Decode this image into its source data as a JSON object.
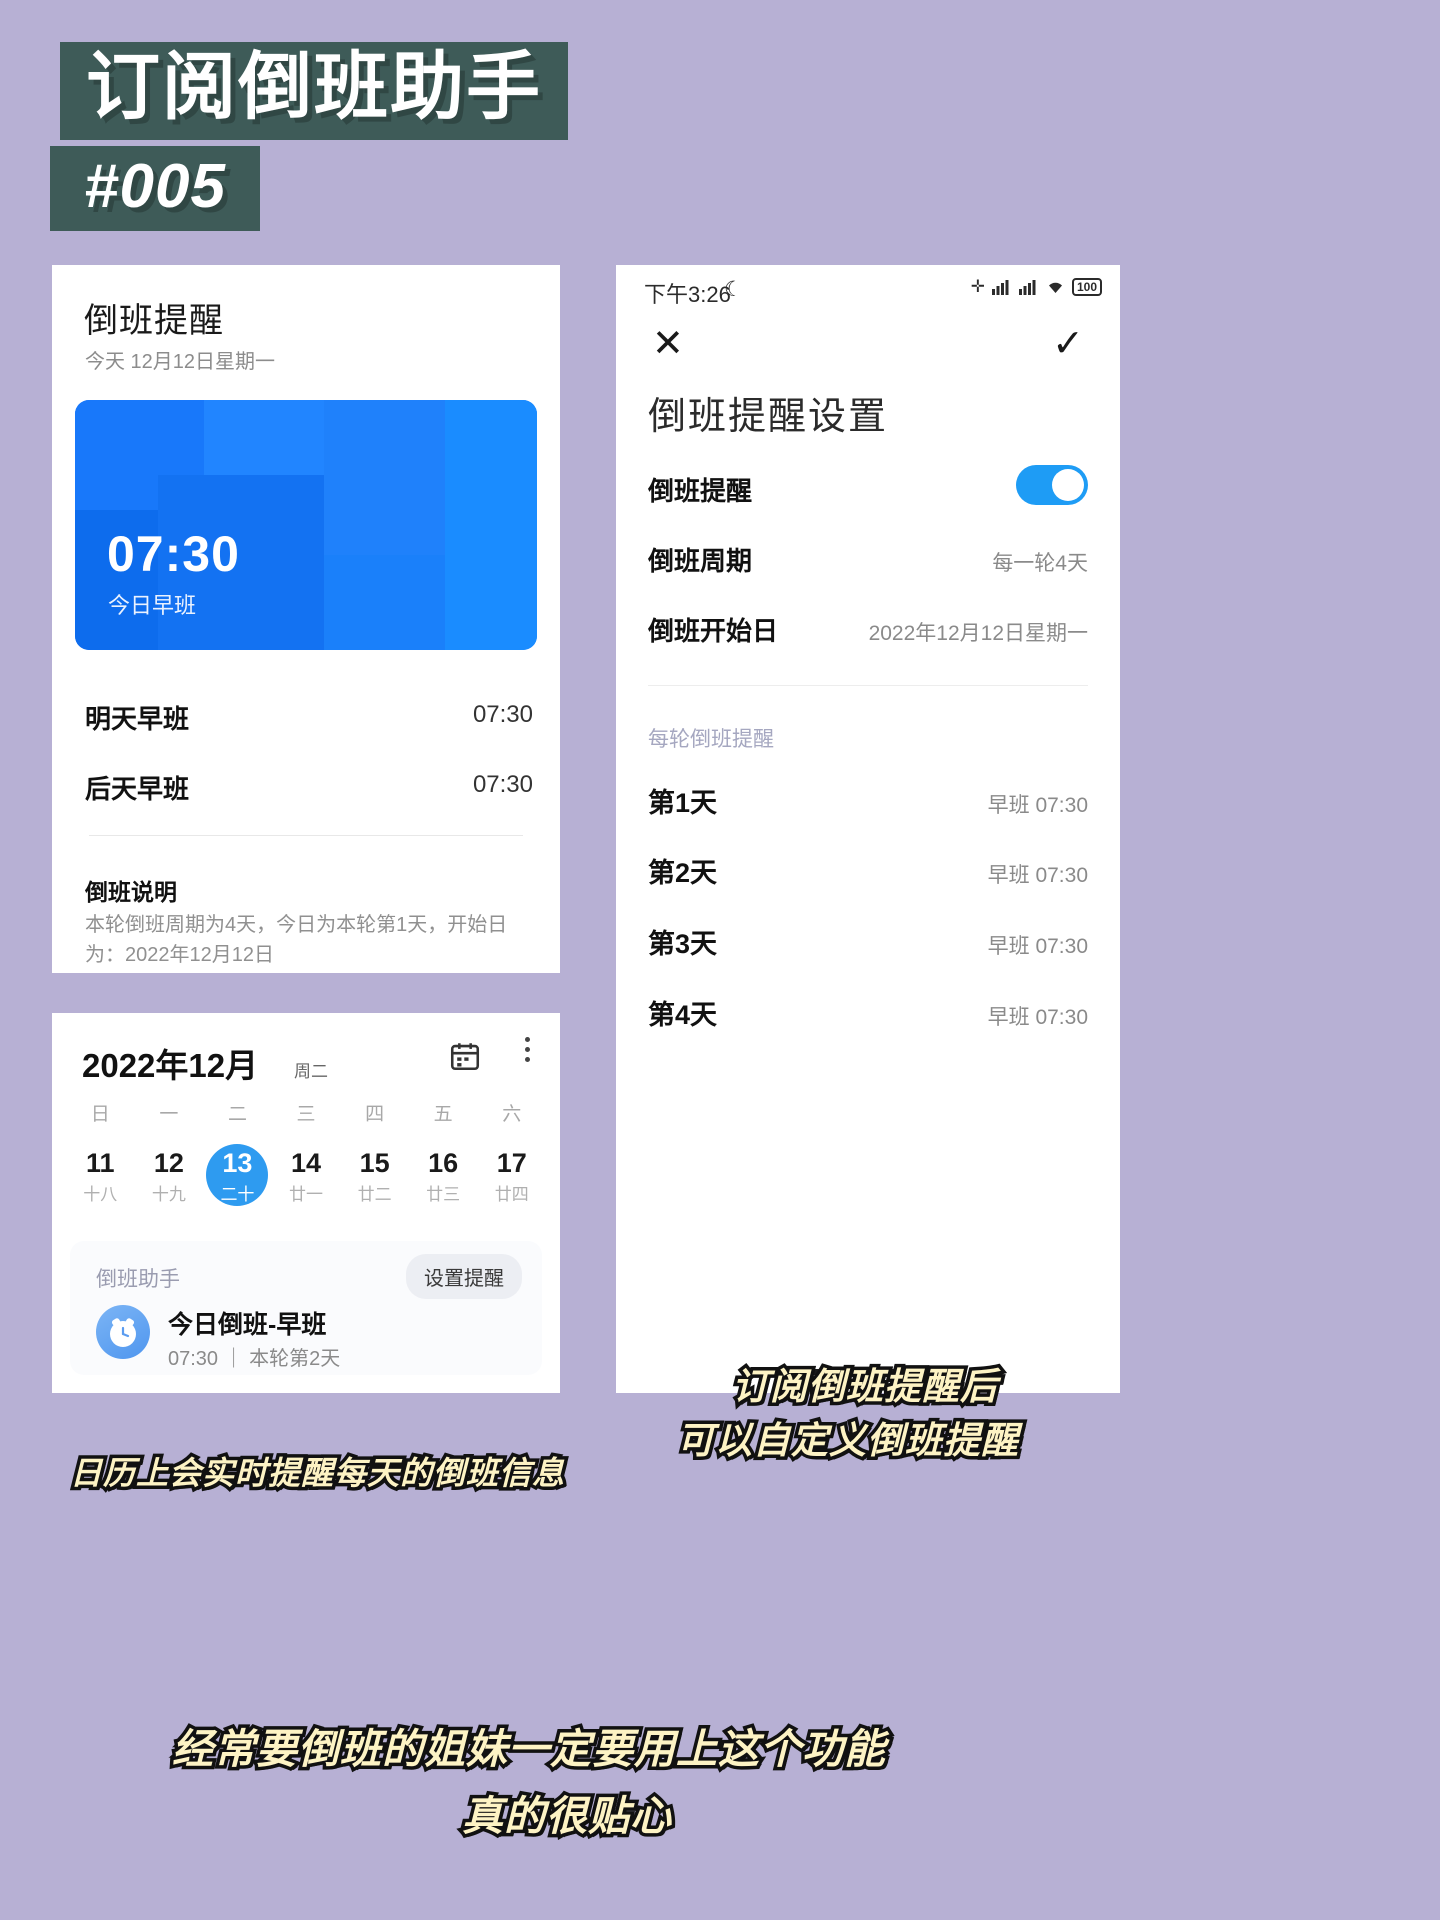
{
  "banner": {
    "title": "订阅倒班助手",
    "subtitle": "#005"
  },
  "left_card": {
    "title": "倒班提醒",
    "subtitle": "今天 12月12日星期一",
    "hero": {
      "time": "07:30",
      "label": "今日早班"
    },
    "shifts": [
      {
        "name": "明天早班",
        "time": "07:30"
      },
      {
        "name": "后天早班",
        "time": "07:30"
      }
    ],
    "explain_title": "倒班说明",
    "explain_body": "本轮倒班周期为4天，今日为本轮第1天，开始日为：2022年12月12日"
  },
  "calendar_card": {
    "month_title": "2022年12月",
    "weekday_small": "周二",
    "calendar_icon": "calendar-icon",
    "more_icon": "more-vertical-icon",
    "weekdays": [
      "日",
      "一",
      "二",
      "三",
      "四",
      "五",
      "六"
    ],
    "days": [
      {
        "num": "11",
        "lunar": "十八",
        "selected": false
      },
      {
        "num": "12",
        "lunar": "十九",
        "selected": false
      },
      {
        "num": "13",
        "lunar": "二十",
        "selected": true
      },
      {
        "num": "14",
        "lunar": "廿一",
        "selected": false
      },
      {
        "num": "15",
        "lunar": "廿二",
        "selected": false
      },
      {
        "num": "16",
        "lunar": "廿三",
        "selected": false
      },
      {
        "num": "17",
        "lunar": "廿四",
        "selected": false
      }
    ],
    "widget": {
      "app_name": "倒班助手",
      "action_label": "设置提醒",
      "icon": "alarm-clock-icon",
      "title": "今日倒班-早班",
      "meta": "07:30 ｜ 本轮第2天"
    }
  },
  "captions": {
    "calendar": "日历上会实时提醒每天的倒班信息",
    "right_line1": "订阅倒班提醒后",
    "right_line2": "可以自定义倒班提醒",
    "bottom_line1": "经常要倒班的姐妹一定要用上这个功能",
    "bottom_line2": "真的很贴心"
  },
  "phone": {
    "status": {
      "time": "下午3:26",
      "moon_icon": "crescent-moon-icon",
      "bluetooth_icon": "bluetooth-icon",
      "signal1_icon": "signal-bars-icon",
      "signal2_icon": "signal-bars-icon",
      "wifi_icon": "wifi-icon",
      "battery": "100"
    },
    "nav": {
      "close_icon": "close-x-icon",
      "confirm_icon": "check-icon"
    },
    "title": "倒班提醒设置",
    "settings": [
      {
        "label": "倒班提醒",
        "value": "",
        "type": "toggle",
        "on": true
      },
      {
        "label": "倒班周期",
        "value": "每一轮4天",
        "type": "value"
      },
      {
        "label": "倒班开始日",
        "value": "2022年12月12日星期一",
        "type": "value"
      }
    ],
    "section_label": "每轮倒班提醒",
    "days": [
      {
        "label": "第1天",
        "value": "早班 07:30"
      },
      {
        "label": "第2天",
        "value": "早班 07:30"
      },
      {
        "label": "第3天",
        "value": "早班 07:30"
      },
      {
        "label": "第4天",
        "value": "早班 07:30"
      }
    ]
  },
  "colors": {
    "background": "#b7b0d4",
    "banner": "#3e5b58",
    "accent_blue": "#1677ff",
    "calendar_select": "#2e9bf0",
    "caption_fill": "#fdf3c4"
  }
}
